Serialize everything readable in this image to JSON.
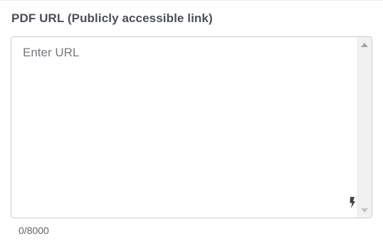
{
  "field": {
    "label": "PDF URL (Publicly accessible link)",
    "placeholder": "Enter URL",
    "value": "",
    "counter": "0/8000"
  },
  "icons": {
    "scroll_up": "scroll-up-arrow-icon",
    "scroll_down": "scroll-down-arrow-icon",
    "extension": "lightning-bolt-icon"
  },
  "colors": {
    "label": "#4a505a",
    "border": "#c9cdd2",
    "placeholder": "#74797f",
    "counter": "#5d6269"
  }
}
